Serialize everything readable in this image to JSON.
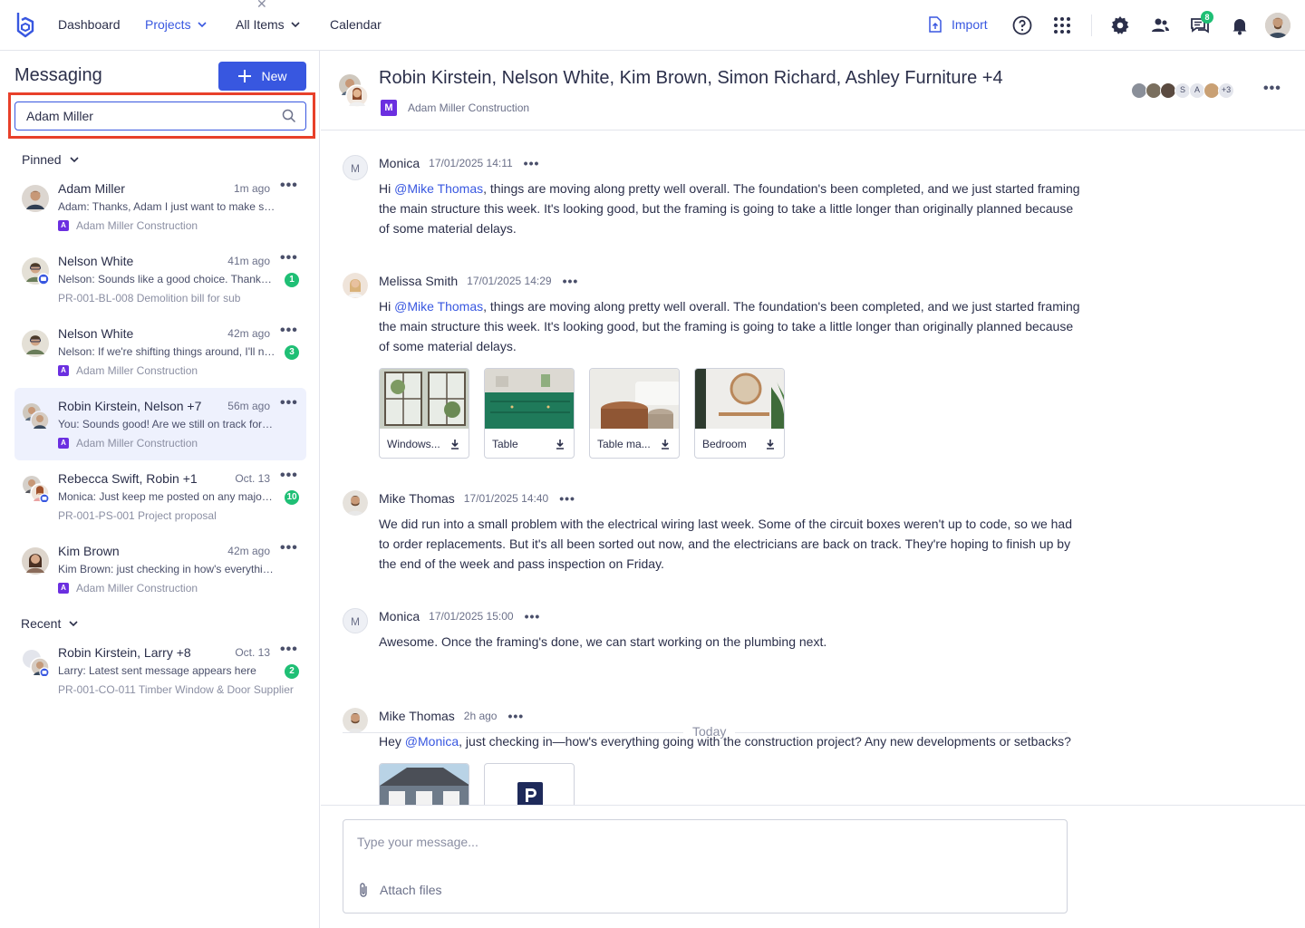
{
  "nav": {
    "items": [
      {
        "label": "Dashboard"
      },
      {
        "label": "Projects"
      },
      {
        "label": "All Items"
      },
      {
        "label": "Calendar"
      }
    ],
    "import_label": "Import",
    "messages_badge": "8",
    "icons": [
      "help-icon",
      "apps-grid-icon",
      "gear-icon",
      "users-icon",
      "chat-icon",
      "bell-icon"
    ]
  },
  "sidebar": {
    "title": "Messaging",
    "new_label": "New",
    "search": {
      "value": "Adam Miller",
      "placeholder": "Search"
    },
    "pinned_label": "Pinned",
    "recent_label": "Recent",
    "pinned": [
      {
        "name": "Adam Miller",
        "time": "1m ago",
        "preview": "Adam: Thanks, Adam I just want to make sure we're all on the same page",
        "unread": "",
        "project": "Adam Miller Construction",
        "tag": "A"
      },
      {
        "name": "Nelson White",
        "time": "41m ago",
        "preview": "Nelson: Sounds like a good choice. Thanks for the update",
        "unread": "1",
        "project": "PR-001-BL-008 Demolition bill for sub",
        "tag": ""
      },
      {
        "name": "Nelson White",
        "time": "42m ago",
        "preview": "Nelson: If we're shifting things around, I'll need to know",
        "unread": "3",
        "project": "Adam Miller Construction",
        "tag": "A"
      },
      {
        "name": "Robin Kirstein, Nelson +7",
        "time": "56m ago",
        "preview": "You: Sounds good! Are we still on track for the inspection",
        "unread": "",
        "project": "Adam Miller Construction",
        "tag": "A"
      },
      {
        "name": "Rebecca Swift, Robin  +1",
        "time": "Oct. 13",
        "preview": "Monica: Just keep me posted on any major changes",
        "unread": "10",
        "project": "PR-001-PS-001 Project proposal",
        "tag": ""
      },
      {
        "name": "Kim Brown",
        "time": "42m ago",
        "preview": "Kim Brown: just checking in how's everything going",
        "unread": "",
        "project": "Adam Miller Construction",
        "tag": "A"
      }
    ],
    "recent": [
      {
        "name": "Robin Kirstein, Larry  +8",
        "time": "Oct. 13",
        "preview": "Larry: Latest sent message appears here",
        "unread": "2",
        "project": "PR-001-CO-011 Timber Window & Door Supplier",
        "tag": ""
      }
    ]
  },
  "conversation": {
    "title": "Robin Kirstein, Nelson White, Kim Brown, Simon Richard, Ashley Furniture +4",
    "project_tag": "M",
    "project": "Adam Miller Construction",
    "participants_more": "+3",
    "participant_letters": [
      "S",
      "A"
    ],
    "today_label": "Today",
    "messages": [
      {
        "author": "Monica",
        "avatar_letter": "M",
        "time": "17/01/2025 14:11",
        "mention": "@Mike Thomas",
        "pre": "Hi ",
        "text": ", things are moving along pretty well overall. The foundation's been completed, and we just started framing the main structure this week. It's looking good, but the framing is going to take a little longer than originally planned because of some material delays."
      },
      {
        "author": "Melissa Smith",
        "avatar_letter": "",
        "time": "17/01/2025 14:29",
        "mention": "@Mike Thomas",
        "pre": "Hi ",
        "text": ", things are moving along pretty well overall. The foundation's been completed, and we just started framing the main structure this week. It's looking good, but the framing is going to take a little longer than originally planned because of some material delays.",
        "attachments": [
          {
            "label": "Windows..."
          },
          {
            "label": "Table"
          },
          {
            "label": "Table ma..."
          },
          {
            "label": "Bedroom"
          }
        ]
      },
      {
        "author": "Mike Thomas",
        "avatar_letter": "",
        "time": "17/01/2025 14:40",
        "mention": "",
        "pre": "",
        "text": "We did run into a small problem with the electrical wiring last week. Some of the circuit boxes weren't up to code, so we had to order replacements. But it's all been sorted out now, and the electricians are back on track. They're hoping to finish up by the end of the week and pass inspection on Friday."
      },
      {
        "author": "Monica",
        "avatar_letter": "M",
        "time": "17/01/2025 15:00",
        "mention": "",
        "pre": "",
        "text": "Awesome. Once the framing's done, we can start working on the plumbing next."
      },
      {
        "author": "Mike Thomas",
        "avatar_letter": "",
        "time": "2h ago",
        "mention": "@Monica",
        "pre": "Hey ",
        "text": ", just checking in—how's everything going with the construction project? Any new developments or setbacks?"
      }
    ]
  },
  "composer": {
    "placeholder": "Type your message...",
    "attach_label": "Attach files"
  },
  "colors": {
    "primary": "#3857e0",
    "unread": "#1fbf75",
    "tag": "#6b2fe0",
    "highlight": "#e8402a"
  }
}
